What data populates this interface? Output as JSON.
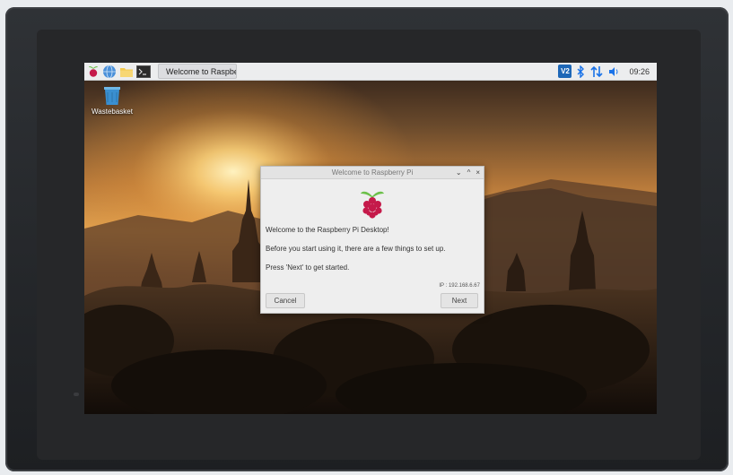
{
  "taskbar": {
    "app_title": "Welcome to Raspberr...",
    "clock": "09:26",
    "vnc_label": "V2",
    "icons": [
      "raspberry-menu-icon",
      "browser-icon",
      "file-manager-icon",
      "terminal-icon"
    ],
    "tray_icons": [
      "vnc-icon",
      "bluetooth-icon",
      "network-icon",
      "volume-icon"
    ]
  },
  "desktop": {
    "wastebasket_label": "Wastebasket"
  },
  "dialog": {
    "title": "Welcome to Raspberry Pi",
    "line1": "Welcome to the Raspberry Pi Desktop!",
    "line2": "Before you start using it, there are a few things to set up.",
    "line3": "Press 'Next' to get started.",
    "ip": "IP : 192.168.6.67",
    "cancel_label": "Cancel",
    "next_label": "Next",
    "minimize_glyph": "⌄",
    "maximize_glyph": "^",
    "close_glyph": "×"
  },
  "colors": {
    "raspberry_red": "#c51a4a",
    "leaf_green": "#6cc04a",
    "vnc_blue": "#1d67b7",
    "bluetooth_blue": "#1a73e8"
  }
}
